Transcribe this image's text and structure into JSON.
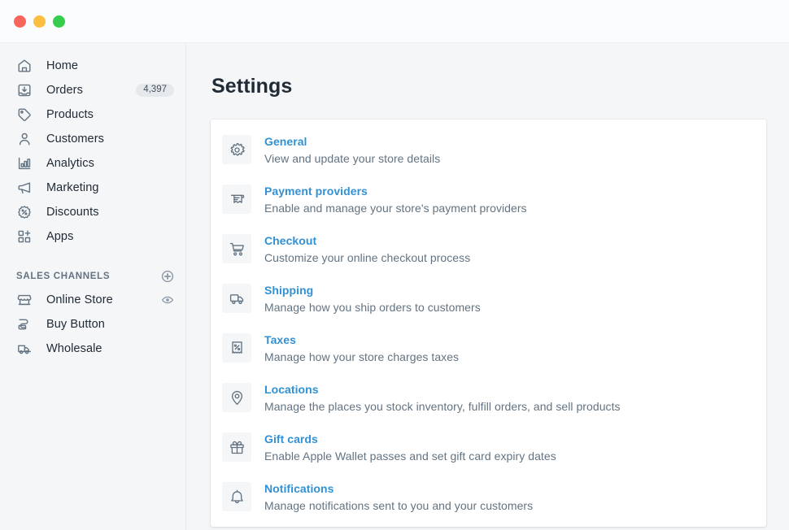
{
  "window": {
    "traffic_lights": [
      {
        "name": "close",
        "color": "#f9655b"
      },
      {
        "name": "minimize",
        "color": "#fbbe40"
      },
      {
        "name": "maximize",
        "color": "#35cd4b"
      }
    ]
  },
  "sidebar": {
    "items": [
      {
        "label": "Home",
        "icon": "home-icon",
        "badge": null,
        "trailing": null
      },
      {
        "label": "Orders",
        "icon": "orders-inbox-icon",
        "badge": "4,397",
        "trailing": null
      },
      {
        "label": "Products",
        "icon": "tag-icon",
        "badge": null,
        "trailing": null
      },
      {
        "label": "Customers",
        "icon": "person-icon",
        "badge": null,
        "trailing": null
      },
      {
        "label": "Analytics",
        "icon": "bar-chart-icon",
        "badge": null,
        "trailing": null
      },
      {
        "label": "Marketing",
        "icon": "megaphone-icon",
        "badge": null,
        "trailing": null
      },
      {
        "label": "Discounts",
        "icon": "discount-percent-icon",
        "badge": null,
        "trailing": null
      },
      {
        "label": "Apps",
        "icon": "apps-grid-plus-icon",
        "badge": null,
        "trailing": null
      }
    ],
    "section": {
      "title": "SALES CHANNELS",
      "action_icon": "plus-circle-icon",
      "items": [
        {
          "label": "Online Store",
          "icon": "storefront-icon",
          "trailing": "eye-icon"
        },
        {
          "label": "Buy Button",
          "icon": "buy-button-icon",
          "trailing": null
        },
        {
          "label": "Wholesale",
          "icon": "wholesale-truck-icon",
          "trailing": null
        }
      ]
    }
  },
  "main": {
    "title": "Settings",
    "settings": [
      {
        "icon": "gear-icon",
        "title": "General",
        "desc": "View and update your store details"
      },
      {
        "icon": "payment-receipt-icon",
        "title": "Payment providers",
        "desc": "Enable and manage your store's payment providers"
      },
      {
        "icon": "shopping-cart-icon",
        "title": "Checkout",
        "desc": "Customize your online checkout process"
      },
      {
        "icon": "truck-icon",
        "title": "Shipping",
        "desc": "Manage how you ship orders to customers"
      },
      {
        "icon": "tax-percent-icon",
        "title": "Taxes",
        "desc": "Manage how your store charges taxes"
      },
      {
        "icon": "map-pin-icon",
        "title": "Locations",
        "desc": "Manage the places you stock inventory, fulfill orders, and sell products"
      },
      {
        "icon": "gift-icon",
        "title": "Gift cards",
        "desc": "Enable Apple Wallet passes and set gift card expiry dates"
      },
      {
        "icon": "bell-icon",
        "title": "Notifications",
        "desc": "Manage notifications sent to you and your customers"
      }
    ]
  },
  "colors": {
    "link": "#3191d4",
    "text": "#212b36",
    "muted": "#637381",
    "page_bg": "#f4f6f8",
    "card_bg": "#ffffff"
  }
}
